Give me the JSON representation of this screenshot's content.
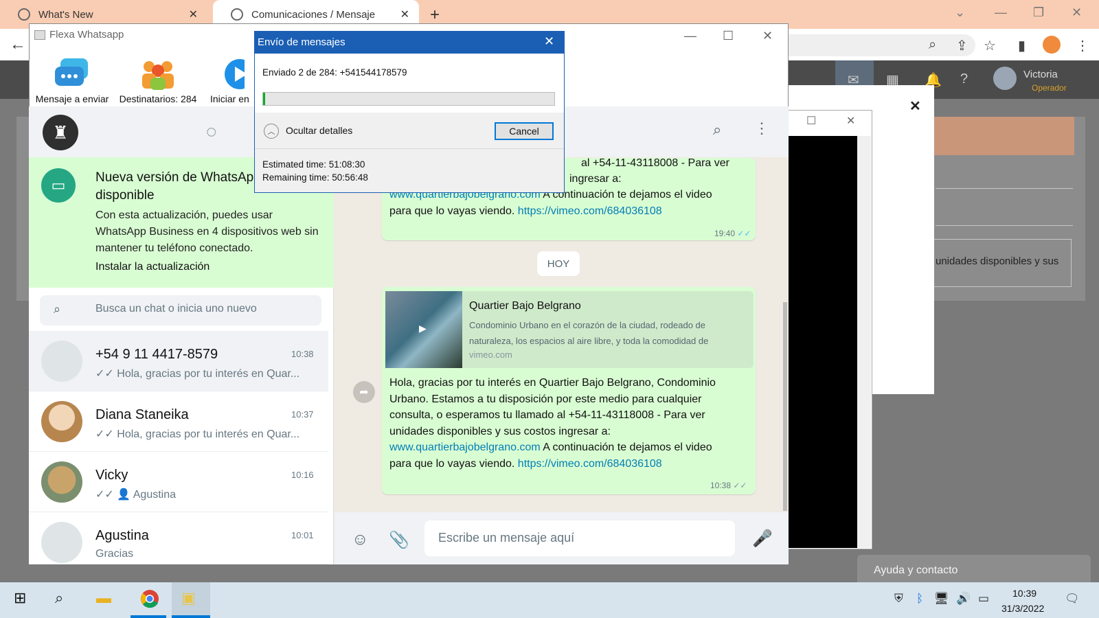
{
  "browser": {
    "tabs": [
      {
        "title": "What's New"
      },
      {
        "title": "Comunicaciones / Mensaje"
      }
    ]
  },
  "web_app": {
    "user_name": "Victoria",
    "user_role": "Operador",
    "modal_text": "unidades disponibles y sus",
    "help_label": "Ayuda y contacto"
  },
  "flexa": {
    "window_title": "Flexa Whatsapp",
    "toolbar": [
      {
        "label": "Mensaje a enviar"
      },
      {
        "label": "Destinatarios: 284"
      },
      {
        "label": "Iniciar en"
      }
    ]
  },
  "dialog": {
    "title": "Envío de mensajes",
    "status": "Enviado 2 de 284: +541544178579",
    "progress": 0.007,
    "hide_details": "Ocultar detalles",
    "cancel": "Cancel",
    "estimated": "Estimated time: 51:08:30",
    "remaining": "Remaining time: 50:56:48"
  },
  "whatsapp": {
    "update": {
      "title": "Nueva versión de WhatsApp disponible",
      "body": "Con esta actualización, puedes usar WhatsApp Business en 4 dispositivos web sin mantener tu teléfono conectado.",
      "action": "Instalar la actualización"
    },
    "search_placeholder": "Busca un chat o inicia uno nuevo",
    "chats": [
      {
        "name": "+54 9 11 4417-8579",
        "time": "10:38",
        "preview": "✓✓ Hola, gracias por tu interés en Quar..."
      },
      {
        "name": "Diana Staneika",
        "time": "10:37",
        "preview": "✓✓ Hola, gracias por tu interés en Quar..."
      },
      {
        "name": "Vicky",
        "time": "10:16",
        "preview": "✓✓ 👤 Agustina"
      },
      {
        "name": "Agustina",
        "time": "10:01",
        "preview": "Gracias"
      }
    ],
    "messages": {
      "first_lines": [
        "al +54-11-43118008  - Para ver",
        "ingresar a:"
      ],
      "first_link1": "www.quartierbajobelgrano.com",
      "first_after": " A continuación te dejamos el video",
      "first_pre2": "para que lo vayas viendo. ",
      "first_link2": "https://vimeo.com/684036108",
      "first_time": "19:40",
      "day_divider": "HOY",
      "preview_title": "Quartier Bajo Belgrano",
      "preview_desc": "Condominio Urbano en el corazón de la ciudad, rodeado de naturaleza, los espacios al aire libre, y toda la comodidad de",
      "preview_site": "vimeo.com",
      "second_text": "Hola, gracias por tu interés en Quartier Bajo Belgrano, Condominio Urbano. Estamos a tu disposición por este medio para cualquier consulta, o esperamos tu llamado al +54-11-43118008  - Para ver unidades disponibles y sus costos ingresar a:",
      "second_link1": "www.quartierbajobelgrano.com",
      "second_after": " A continuación te dejamos el video",
      "second_pre2": "para que lo vayas viendo. ",
      "second_link2": "https://vimeo.com/684036108",
      "second_time": "10:38"
    },
    "composer_placeholder": "Escribe un mensaje aquí"
  },
  "taskbar": {
    "time": "10:39",
    "date": "31/3/2022"
  }
}
